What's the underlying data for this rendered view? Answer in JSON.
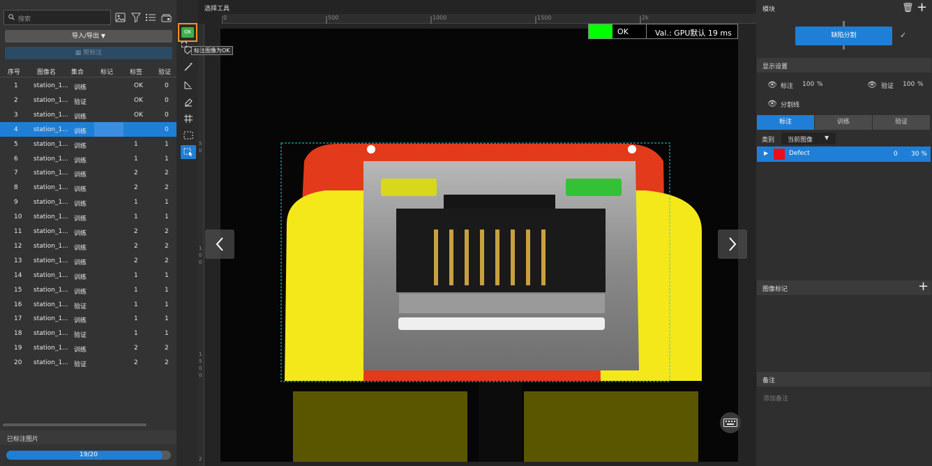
{
  "left": {
    "search_placeholder": "搜索",
    "import_export_label": "导入/导出",
    "annotate_label": "帮标注",
    "columns": [
      "序号",
      "图像名",
      "集合",
      "标记",
      "标签",
      "验证"
    ],
    "rows": [
      {
        "id": "1",
        "name": "station_1...",
        "set": "训练",
        "mark": "",
        "label": "OK",
        "val": "0"
      },
      {
        "id": "2",
        "name": "station_1...",
        "set": "验证",
        "mark": "",
        "label": "OK",
        "val": "0"
      },
      {
        "id": "3",
        "name": "station_1...",
        "set": "训练",
        "mark": "",
        "label": "OK",
        "val": "0"
      },
      {
        "id": "4",
        "name": "station_1...",
        "set": "训练",
        "mark": "",
        "label": "",
        "val": "0"
      },
      {
        "id": "5",
        "name": "station_1...",
        "set": "训练",
        "mark": "",
        "label": "1",
        "val": "1"
      },
      {
        "id": "6",
        "name": "station_1...",
        "set": "训练",
        "mark": "",
        "label": "1",
        "val": "1"
      },
      {
        "id": "7",
        "name": "station_1...",
        "set": "训练",
        "mark": "",
        "label": "2",
        "val": "2"
      },
      {
        "id": "8",
        "name": "station_1...",
        "set": "训练",
        "mark": "",
        "label": "2",
        "val": "2"
      },
      {
        "id": "9",
        "name": "station_1...",
        "set": "训练",
        "mark": "",
        "label": "1",
        "val": "1"
      },
      {
        "id": "10",
        "name": "station_1...",
        "set": "训练",
        "mark": "",
        "label": "1",
        "val": "1"
      },
      {
        "id": "11",
        "name": "station_1...",
        "set": "训练",
        "mark": "",
        "label": "2",
        "val": "2"
      },
      {
        "id": "12",
        "name": "station_1...",
        "set": "训练",
        "mark": "",
        "label": "2",
        "val": "2"
      },
      {
        "id": "13",
        "name": "station_1...",
        "set": "训练",
        "mark": "",
        "label": "2",
        "val": "2"
      },
      {
        "id": "14",
        "name": "station_1...",
        "set": "训练",
        "mark": "",
        "label": "1",
        "val": "1"
      },
      {
        "id": "15",
        "name": "station_1...",
        "set": "训练",
        "mark": "",
        "label": "1",
        "val": "1"
      },
      {
        "id": "16",
        "name": "station_1...",
        "set": "验证",
        "mark": "",
        "label": "1",
        "val": "1"
      },
      {
        "id": "17",
        "name": "station_1...",
        "set": "训练",
        "mark": "",
        "label": "1",
        "val": "1"
      },
      {
        "id": "18",
        "name": "station_1...",
        "set": "验证",
        "mark": "",
        "label": "1",
        "val": "1"
      },
      {
        "id": "19",
        "name": "station_1...",
        "set": "训练",
        "mark": "",
        "label": "2",
        "val": "2"
      },
      {
        "id": "20",
        "name": "station_1...",
        "set": "验证",
        "mark": "",
        "label": "2",
        "val": "2"
      }
    ],
    "selected_row": "4",
    "annotated_header": "已标注图片",
    "progress_text": "19/20",
    "progress_fraction": 0.95
  },
  "toolbar": {
    "ok_label": "OK",
    "tooltip": "标注图像为OK"
  },
  "canvas": {
    "title": "选择工具",
    "ruler_top": [
      "0",
      "500",
      "1000",
      "1500",
      "2k"
    ],
    "ruler_left": [
      "5",
      "0",
      "1",
      "0",
      "0",
      "1",
      "5",
      "0",
      "0",
      "2"
    ],
    "status": "OK",
    "status_color": "#00ff00",
    "val_text": "Val.:  GPU默认 19 ms"
  },
  "right": {
    "module_header": "模块",
    "module_button": "缺陷分割",
    "display_header": "显示设置",
    "annot_label": "标注",
    "annot_pct": "100",
    "verify_label": "验证",
    "verify_pct": "100",
    "pct_unit": "%",
    "divider_label": "分割线",
    "tabs": [
      "标注",
      "训练",
      "验证"
    ],
    "category_label": "类别",
    "category_select": "当前图像",
    "class_name": "Defect",
    "class_color": "#e8101a",
    "class_count": "0",
    "class_pct": "30 %",
    "image_tags_header": "图像标记",
    "notes_header": "备注",
    "notes_placeholder": "添加备注"
  }
}
